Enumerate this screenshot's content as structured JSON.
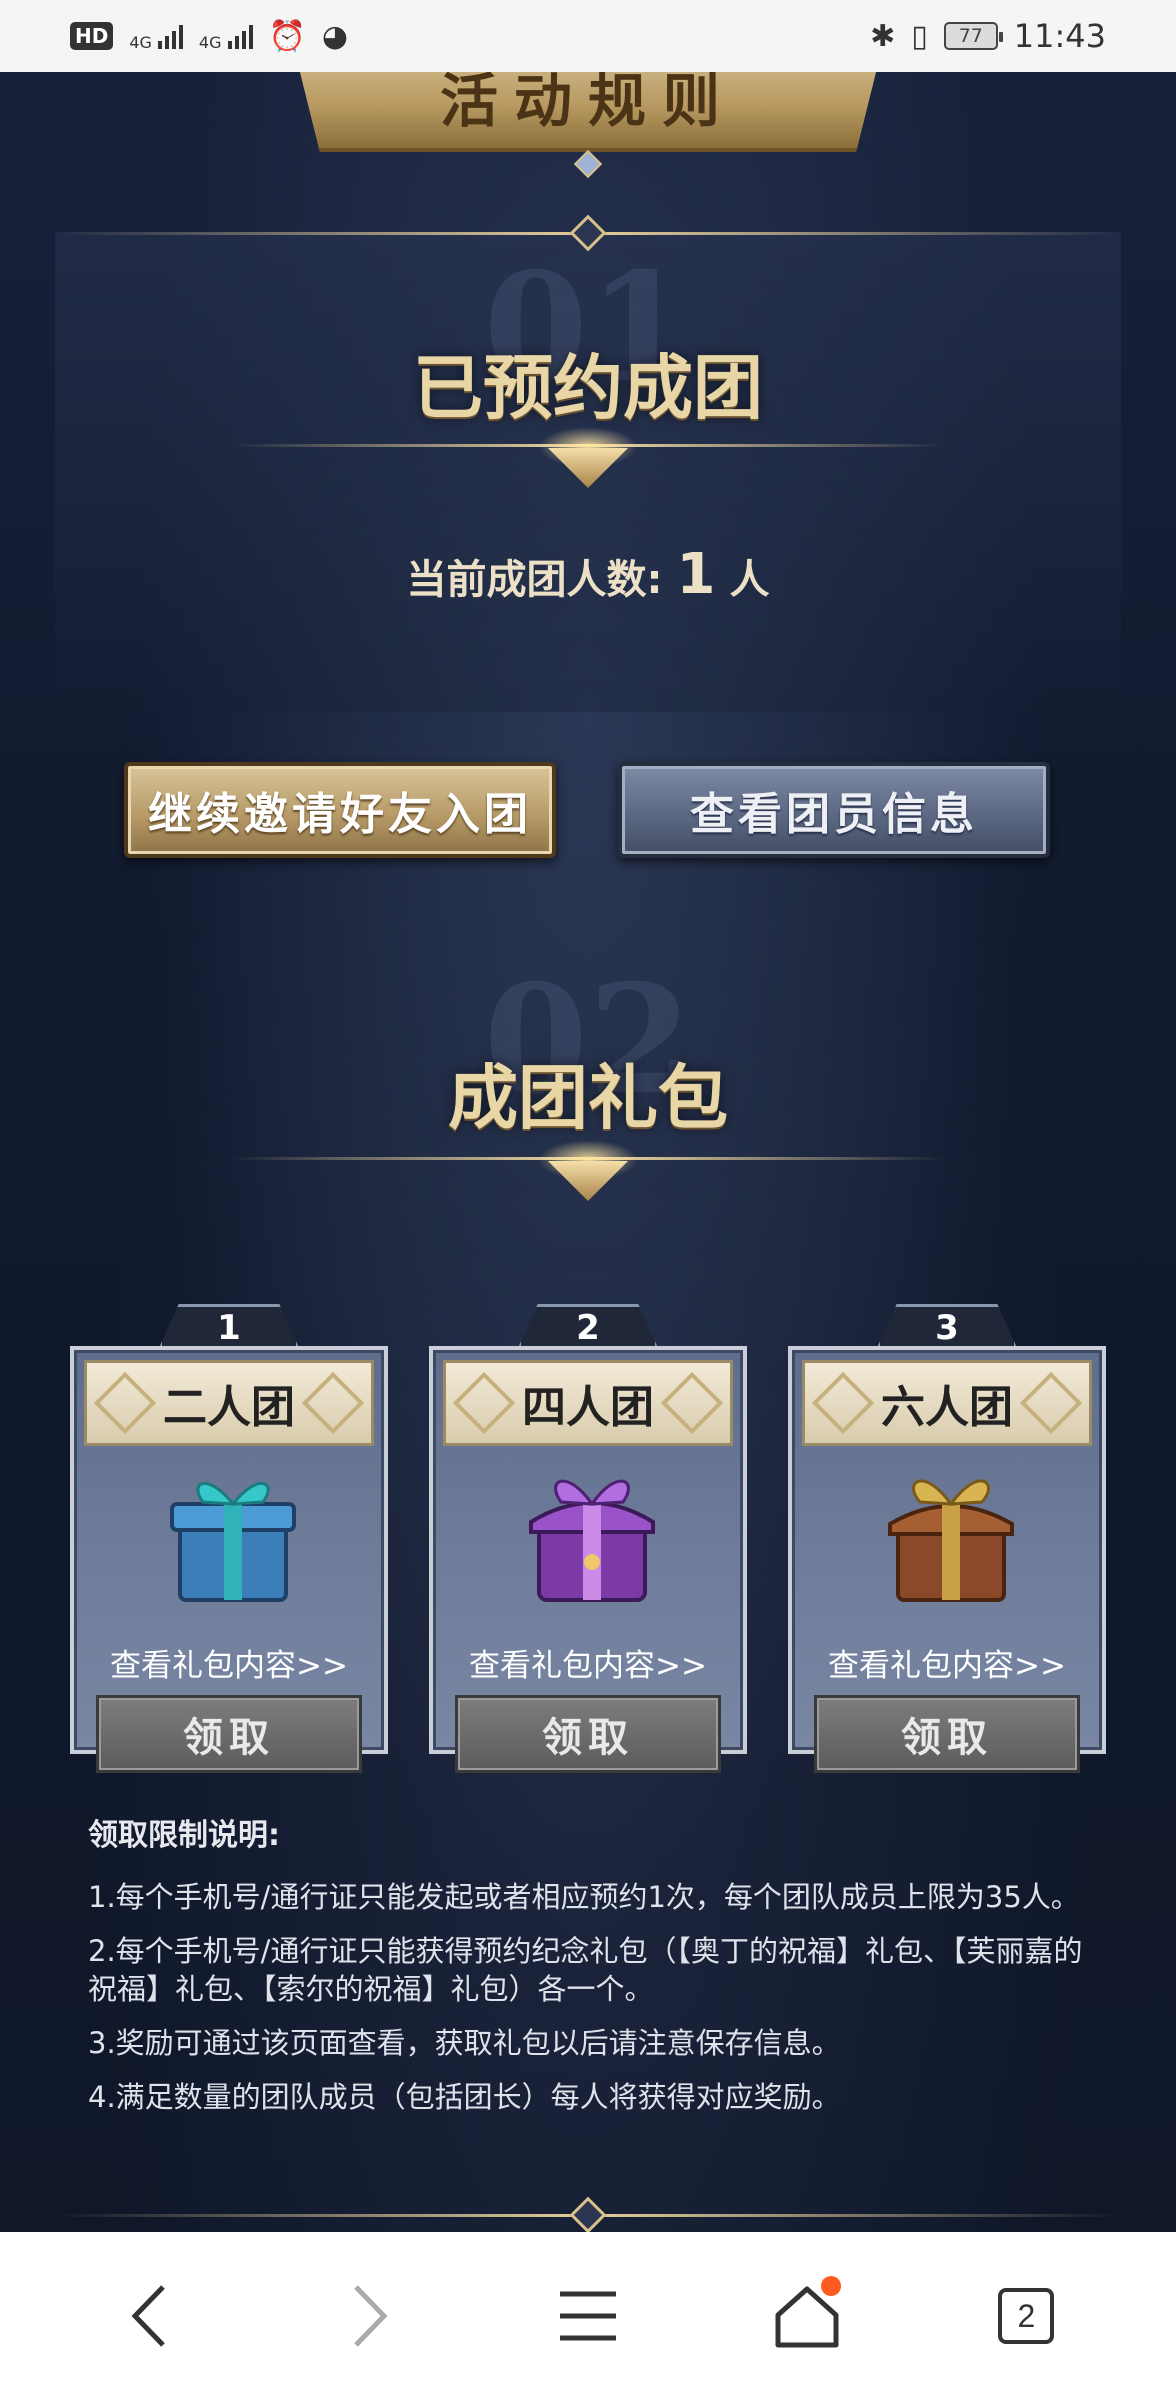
{
  "status_bar": {
    "hd": "HD",
    "net1": "4G",
    "net2": "4G",
    "battery": "77",
    "time": "11:43"
  },
  "header": {
    "rules_banner": "活动规则"
  },
  "section1": {
    "number": "01",
    "title": "已预约成团",
    "count_label": "当前成团人数:",
    "count_value": "1",
    "count_unit": "人",
    "invite_button": "继续邀请好友入团",
    "members_button": "查看团员信息"
  },
  "section2": {
    "number": "02",
    "title": "成团礼包",
    "cards": [
      {
        "index": "1",
        "name": "二人团",
        "link": "查看礼包内容>>",
        "button": "领取",
        "gift_color": "#2fb3b8"
      },
      {
        "index": "2",
        "name": "四人团",
        "link": "查看礼包内容>>",
        "button": "领取",
        "gift_color": "#8a43b8"
      },
      {
        "index": "3",
        "name": "六人团",
        "link": "查看礼包内容>>",
        "button": "领取",
        "gift_color": "#b98a3a"
      }
    ]
  },
  "notes": {
    "heading": "领取限制说明:",
    "items": [
      "1.每个手机号/通行证只能发起或者相应预约1次，每个团队成员上限为35人。",
      "2.每个手机号/通行证只能获得预约纪念礼包（【奥丁的祝福】礼包、【芙丽嘉的祝福】礼包、【索尔的祝福】礼包）各一个。",
      "3.奖励可通过该页面查看，获取礼包以后请注意保存信息。",
      "4.满足数量的团队成员（包括团长）每人将获得对应奖励。"
    ]
  },
  "navbar": {
    "tab_count": "2",
    "icons": [
      "back-icon",
      "forward-icon",
      "menu-icon",
      "home-icon",
      "tabs-icon"
    ]
  }
}
